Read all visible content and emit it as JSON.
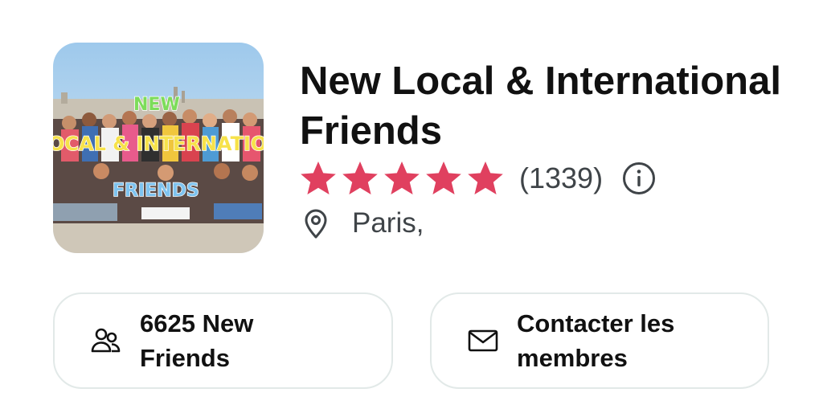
{
  "group": {
    "title": "New Local & International Friends",
    "rating_count": "(1339)",
    "stars": 5,
    "location": "Paris,",
    "photo": {
      "overlay_line1": "NEW",
      "overlay_line2": "LOCAL & INTERNATIONAL",
      "overlay_line3": "FRIENDS"
    }
  },
  "actions": {
    "members_label": "6625 New Friends",
    "contact_label": "Contacter les membres"
  },
  "colors": {
    "star": "#e0405f",
    "border": "#e2e9e8",
    "secondary_text": "#3f4448"
  },
  "icons": {
    "info": "info-circle-icon",
    "location": "map-pin-icon",
    "members": "users-icon",
    "contact": "envelope-icon"
  }
}
